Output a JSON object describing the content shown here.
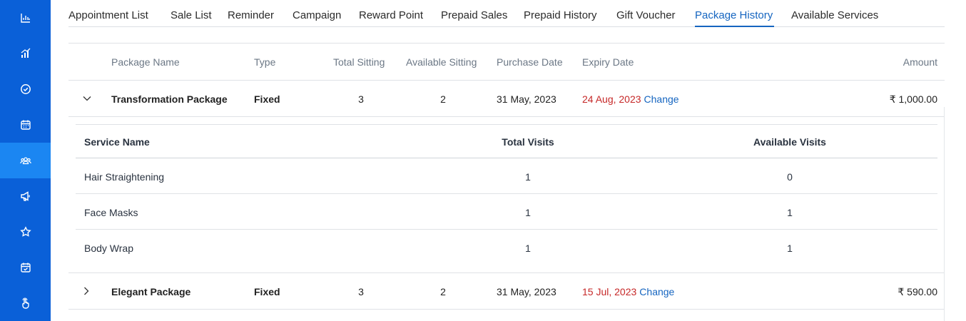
{
  "sidebar": {
    "items": [
      {
        "icon": "bar-chart-icon"
      },
      {
        "icon": "signal-chart-icon"
      },
      {
        "icon": "check-circle-icon"
      },
      {
        "icon": "calendar-icon"
      },
      {
        "icon": "group-icon",
        "active": true
      },
      {
        "icon": "megaphone-icon"
      },
      {
        "icon": "star-icon"
      },
      {
        "icon": "calendar-check-icon"
      },
      {
        "icon": "hand-pointer-icon"
      }
    ],
    "bg_color": "#0a60d8",
    "active_color": "#1b86f2"
  },
  "tabs": [
    {
      "label": "Appointment List"
    },
    {
      "label": "Sale List"
    },
    {
      "label": "Reminder"
    },
    {
      "label": "Campaign"
    },
    {
      "label": "Reward Point"
    },
    {
      "label": "Prepaid Sales"
    },
    {
      "label": "Prepaid History"
    },
    {
      "label": "Gift Voucher"
    },
    {
      "label": "Package History",
      "active": true
    },
    {
      "label": "Available Services"
    }
  ],
  "table": {
    "headers": {
      "package_name": "Package Name",
      "type": "Type",
      "total_sitting": "Total Sitting",
      "available_sitting": "Available Sitting",
      "purchase_date": "Purchase Date",
      "expiry_date": "Expiry Date",
      "amount": "Amount"
    },
    "rows": [
      {
        "expanded": true,
        "package_name": "Transformation Package",
        "type": "Fixed",
        "total_sitting": "3",
        "available_sitting": "2",
        "purchase_date": "31 May, 2023",
        "expiry_date": "24 Aug, 2023",
        "change_label": "Change",
        "amount": "₹ 1,000.00",
        "services": {
          "headers": {
            "service_name": "Service Name",
            "total_visits": "Total Visits",
            "available_visits": "Available Visits"
          },
          "rows": [
            {
              "service_name": "Hair Straightening",
              "total_visits": "1",
              "available_visits": "0"
            },
            {
              "service_name": "Face Masks",
              "total_visits": "1",
              "available_visits": "1"
            },
            {
              "service_name": "Body Wrap",
              "total_visits": "1",
              "available_visits": "1"
            }
          ]
        }
      },
      {
        "expanded": false,
        "package_name": "Elegant Package",
        "type": "Fixed",
        "total_sitting": "3",
        "available_sitting": "2",
        "purchase_date": "31 May, 2023",
        "expiry_date": "15 Jul, 2023",
        "change_label": "Change",
        "amount": "₹ 590.00"
      }
    ]
  },
  "colors": {
    "accent": "#1565c0",
    "expiry_red": "#c62828"
  }
}
